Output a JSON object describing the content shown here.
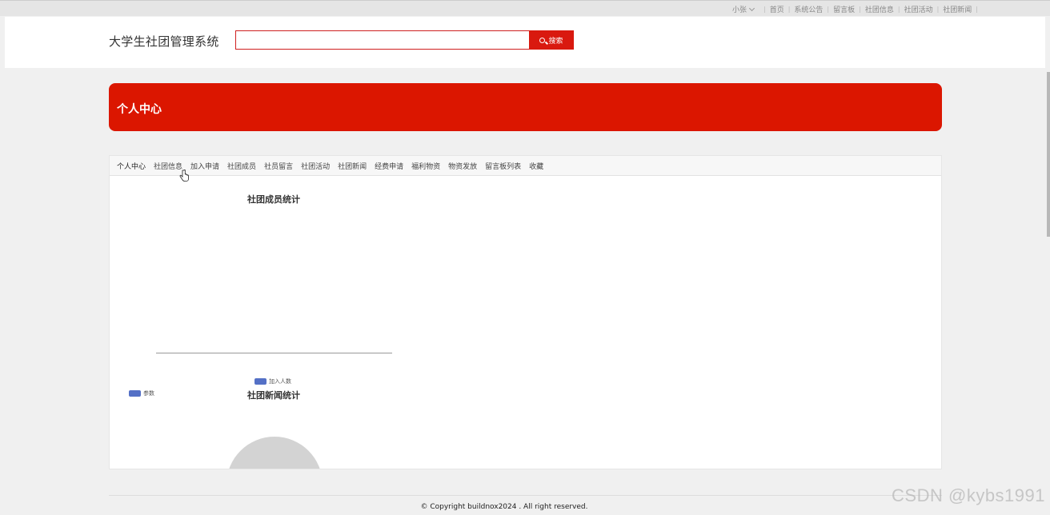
{
  "topnav": {
    "user": "小张",
    "items": [
      "首页",
      "系统公告",
      "留言板",
      "社团信息",
      "社团活动",
      "社团新闻"
    ]
  },
  "header": {
    "site_title": "大学生社团管理系统",
    "search_value": "",
    "search_label": "搜索"
  },
  "banner": {
    "title": "个人中心"
  },
  "tabs": [
    "个人中心",
    "社团信息",
    "加入申请",
    "社团成员",
    "社员留言",
    "社团活动",
    "社团新闻",
    "经费申请",
    "福利物资",
    "物资发放",
    "留言板列表",
    "收藏"
  ],
  "charts": [
    {
      "title": "社团成员统计",
      "legend": "加入人数",
      "type": "bar"
    },
    {
      "title": "社团新闻统计",
      "legend": "参数",
      "type": "pie"
    }
  ],
  "footer": {
    "copyright": "© Copyright buildnox2024 . All right reserved."
  },
  "watermark": "CSDN @kybs1991",
  "colors": {
    "accent": "#db1600",
    "series": "#5470c6"
  }
}
